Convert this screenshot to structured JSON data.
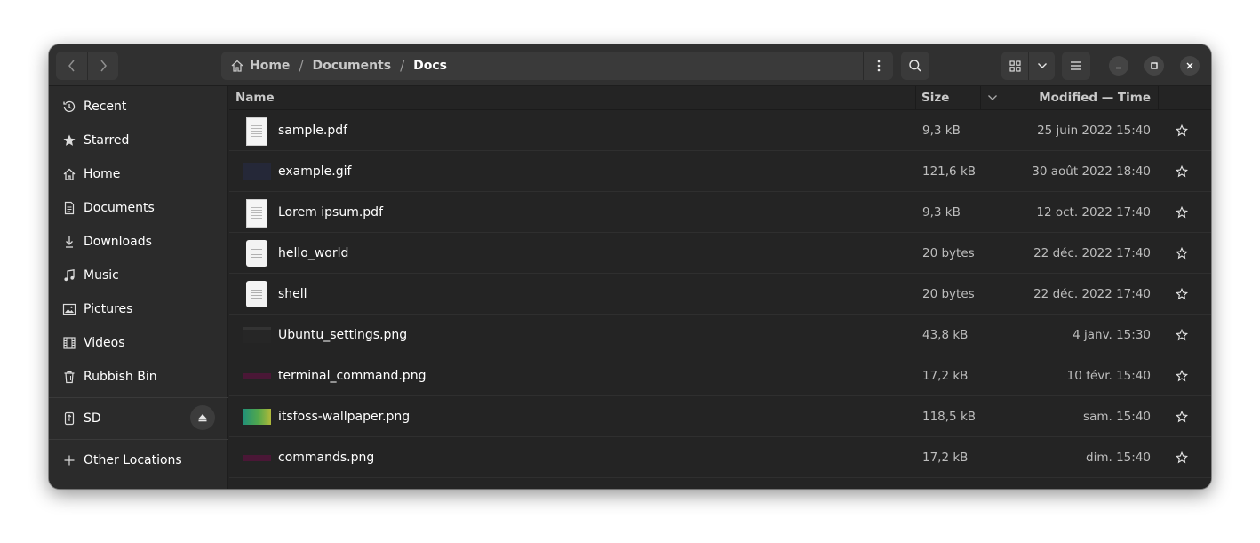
{
  "nav": {
    "back_icon": "chevron-left-icon",
    "forward_icon": "chevron-right-icon"
  },
  "path": {
    "home": "Home",
    "separator": "/",
    "documents": "Documents",
    "current": "Docs"
  },
  "columns": {
    "name": "Name",
    "size": "Size",
    "modified": "Modified — Time"
  },
  "sidebar": {
    "items": [
      {
        "label": "Recent",
        "icon": "clock-icon"
      },
      {
        "label": "Starred",
        "icon": "star-icon"
      },
      {
        "label": "Home",
        "icon": "home-icon"
      },
      {
        "label": "Documents",
        "icon": "document-icon"
      },
      {
        "label": "Downloads",
        "icon": "download-icon"
      },
      {
        "label": "Music",
        "icon": "music-icon"
      },
      {
        "label": "Pictures",
        "icon": "picture-icon"
      },
      {
        "label": "Videos",
        "icon": "film-icon"
      },
      {
        "label": "Rubbish Bin",
        "icon": "trash-icon"
      }
    ],
    "device": {
      "label": "SD",
      "icon": "usb-drive-icon"
    },
    "other": {
      "label": "Other Locations",
      "icon": "plus-icon"
    }
  },
  "files": [
    {
      "name": "sample.pdf",
      "size": "9,3 kB",
      "modified": "25 juin 2022 15:40",
      "thumb": "pdf"
    },
    {
      "name": "example.gif",
      "size": "121,6 kB",
      "modified": "30 août 2022 18:40",
      "thumb": "gif"
    },
    {
      "name": "Lorem ipsum.pdf",
      "size": "9,3 kB",
      "modified": "12 oct. 2022 17:40",
      "thumb": "pdf"
    },
    {
      "name": "hello_world",
      "size": "20 bytes",
      "modified": "22 déc. 2022 17:40",
      "thumb": "text"
    },
    {
      "name": "shell",
      "size": "20 bytes",
      "modified": "22 déc. 2022 17:40",
      "thumb": "text"
    },
    {
      "name": "Ubuntu_settings.png",
      "size": "43,8 kB",
      "modified": "4 janv. 15:30",
      "thumb": "png-dark"
    },
    {
      "name": "terminal_command.png",
      "size": "17,2 kB",
      "modified": "10 févr. 15:40",
      "thumb": "png-purple"
    },
    {
      "name": "itsfoss-wallpaper.png",
      "size": "118,5 kB",
      "modified": "sam. 15:40",
      "thumb": "png-gradient"
    },
    {
      "name": "commands.png",
      "size": "17,2 kB",
      "modified": "dim. 15:40",
      "thumb": "png-purple"
    }
  ],
  "colors": {
    "window_bg": "#242424",
    "headerbar_bg": "#303030",
    "sidebar_bg": "#2b2b2b",
    "button_bg": "#3a3a3a",
    "text_primary": "#ffffff",
    "text_secondary": "#bdbdbd"
  }
}
